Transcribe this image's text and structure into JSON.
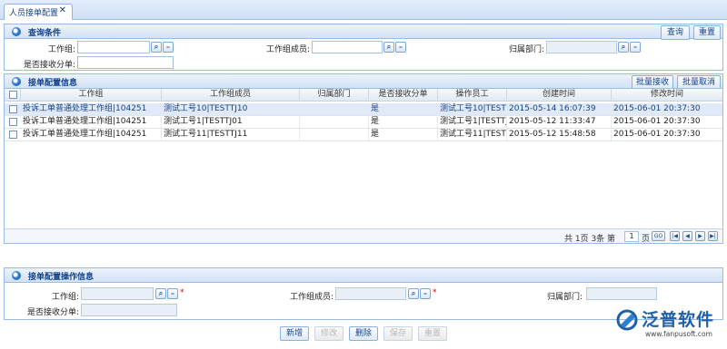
{
  "tab": {
    "title": "人员接单配置",
    "close": "✕"
  },
  "query": {
    "title": "查询条件",
    "search_label": "查询",
    "reset_label": "重置",
    "fields": {
      "group_label": "工作组:",
      "member_label": "工作组成员:",
      "dept_label": "归属部门:",
      "accept_label": "是否接收分单:"
    }
  },
  "config": {
    "title": "接单配置信息",
    "batch_accept_label": "批量接收",
    "batch_cancel_label": "批量取消",
    "columns": [
      "工作组",
      "工作组成员",
      "归属部门",
      "是否接收分单",
      "操作员工",
      "创建时间",
      "修改时间"
    ],
    "rows": [
      {
        "group": "投诉工单普通处理工作组|104251",
        "member": "测试工号10|TESTTJ10",
        "dept": "",
        "accept": "是",
        "operator": "测试工号10|TESTT",
        "created": "2015-05-14 16:07:39",
        "modified": "2015-06-01 20:37:30"
      },
      {
        "group": "投诉工单普通处理工作组|104251",
        "member": "测试工号1|TESTTJ01",
        "dept": "",
        "accept": "是",
        "operator": "测试工号1|TESTTJ",
        "created": "2015-05-12 11:33:47",
        "modified": "2015-06-01 20:37:30"
      },
      {
        "group": "投诉工单普通处理工作组|104251",
        "member": "测试工号11|TESTTJ11",
        "dept": "",
        "accept": "是",
        "operator": "测试工号11|TESTT",
        "created": "2015-05-12 15:48:58",
        "modified": "2015-06-01 20:37:30"
      }
    ],
    "pager": {
      "total_text": "共 1页 3条 第",
      "page_value": "1",
      "page_suffix": "页",
      "go_label": "GO"
    }
  },
  "op": {
    "title": "接单配置操作信息",
    "fields": {
      "group_label": "工作组:",
      "member_label": "工作组成员:",
      "dept_label": "归属部门:",
      "accept_label": "是否接收分单:"
    },
    "required_mark": "*"
  },
  "actions": {
    "add": "新增",
    "edit": "修改",
    "delete": "删除",
    "save": "保存",
    "reset": "重置"
  },
  "logo": {
    "brand": "泛普软件",
    "url": "www.fanpusoft.com"
  },
  "colors": {
    "header_blue": "#15428b",
    "border_blue": "#99bbe8",
    "selected_row": "#dfe9f7",
    "logo_blue": "#1f5fa8"
  }
}
